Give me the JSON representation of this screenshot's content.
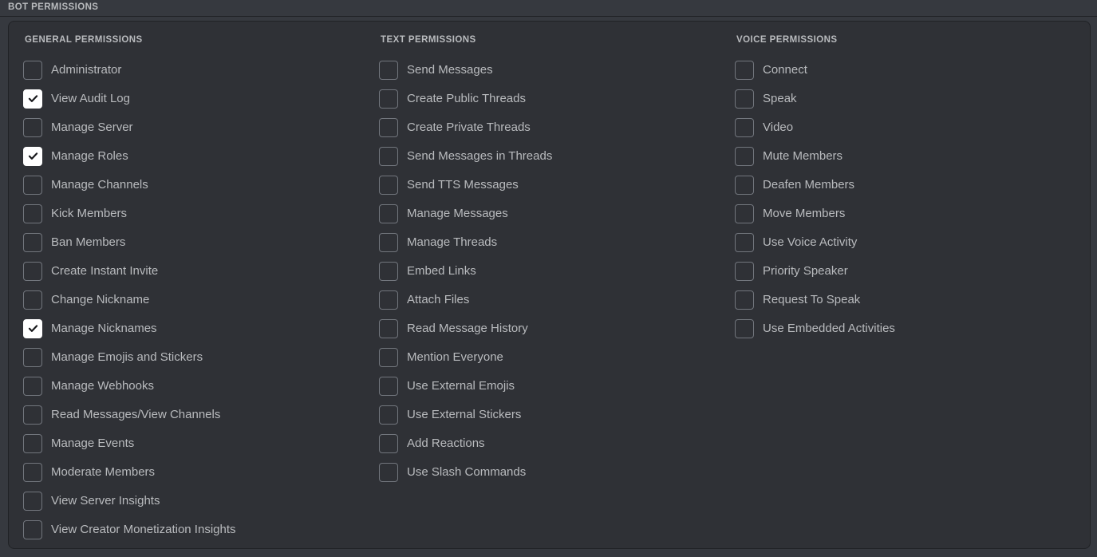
{
  "header": {
    "title": "BOT PERMISSIONS"
  },
  "colors": {
    "page_background": "#36393f",
    "panel_background": "#2f3136",
    "panel_border": "#202225",
    "label_text": "#b9bbbe",
    "checkbox_border": "#72767d",
    "checkbox_checked_fill": "#ffffff",
    "checkmark": "#18191c"
  },
  "columns": [
    {
      "id": "general",
      "title": "GENERAL PERMISSIONS",
      "items": [
        {
          "label": "Administrator",
          "checked": false
        },
        {
          "label": "View Audit Log",
          "checked": true
        },
        {
          "label": "Manage Server",
          "checked": false
        },
        {
          "label": "Manage Roles",
          "checked": true
        },
        {
          "label": "Manage Channels",
          "checked": false
        },
        {
          "label": "Kick Members",
          "checked": false
        },
        {
          "label": "Ban Members",
          "checked": false
        },
        {
          "label": "Create Instant Invite",
          "checked": false
        },
        {
          "label": "Change Nickname",
          "checked": false
        },
        {
          "label": "Manage Nicknames",
          "checked": true
        },
        {
          "label": "Manage Emojis and Stickers",
          "checked": false
        },
        {
          "label": "Manage Webhooks",
          "checked": false
        },
        {
          "label": "Read Messages/View Channels",
          "checked": false
        },
        {
          "label": "Manage Events",
          "checked": false
        },
        {
          "label": "Moderate Members",
          "checked": false
        },
        {
          "label": "View Server Insights",
          "checked": false
        },
        {
          "label": "View Creator Monetization Insights",
          "checked": false
        }
      ]
    },
    {
      "id": "text",
      "title": "TEXT PERMISSIONS",
      "items": [
        {
          "label": "Send Messages",
          "checked": false
        },
        {
          "label": "Create Public Threads",
          "checked": false
        },
        {
          "label": "Create Private Threads",
          "checked": false
        },
        {
          "label": "Send Messages in Threads",
          "checked": false
        },
        {
          "label": "Send TTS Messages",
          "checked": false
        },
        {
          "label": "Manage Messages",
          "checked": false
        },
        {
          "label": "Manage Threads",
          "checked": false
        },
        {
          "label": "Embed Links",
          "checked": false
        },
        {
          "label": "Attach Files",
          "checked": false
        },
        {
          "label": "Read Message History",
          "checked": false
        },
        {
          "label": "Mention Everyone",
          "checked": false
        },
        {
          "label": "Use External Emojis",
          "checked": false
        },
        {
          "label": "Use External Stickers",
          "checked": false
        },
        {
          "label": "Add Reactions",
          "checked": false
        },
        {
          "label": "Use Slash Commands",
          "checked": false
        }
      ]
    },
    {
      "id": "voice",
      "title": "VOICE PERMISSIONS",
      "items": [
        {
          "label": "Connect",
          "checked": false
        },
        {
          "label": "Speak",
          "checked": false
        },
        {
          "label": "Video",
          "checked": false
        },
        {
          "label": "Mute Members",
          "checked": false
        },
        {
          "label": "Deafen Members",
          "checked": false
        },
        {
          "label": "Move Members",
          "checked": false
        },
        {
          "label": "Use Voice Activity",
          "checked": false
        },
        {
          "label": "Priority Speaker",
          "checked": false
        },
        {
          "label": "Request To Speak",
          "checked": false
        },
        {
          "label": "Use Embedded Activities",
          "checked": false
        }
      ]
    }
  ]
}
